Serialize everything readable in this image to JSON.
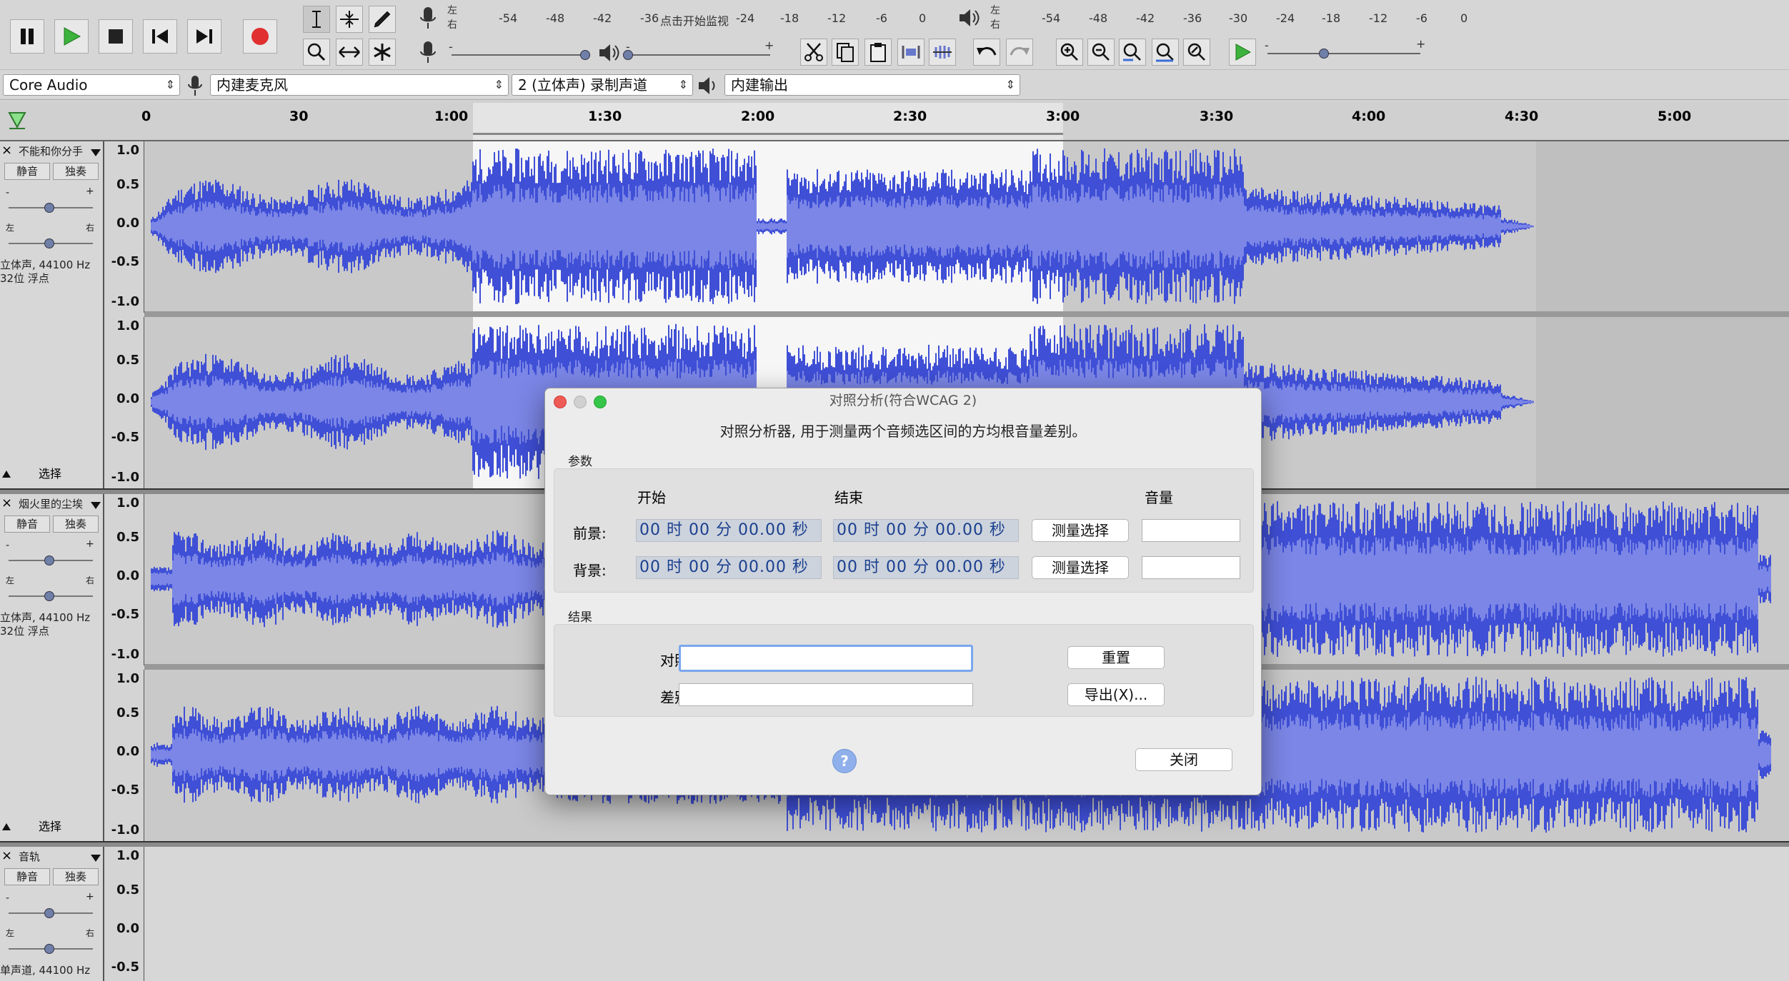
{
  "toolbar": {
    "meter_rec_lr": [
      "左",
      "右"
    ],
    "meter_rec_ticks": [
      "-54",
      "-48",
      "-42",
      "-36",
      "点击开始监视",
      "-24",
      "-18",
      "-12",
      "-6",
      "0"
    ],
    "meter_play_lr": [
      "左",
      "右"
    ],
    "meter_play_ticks": [
      "-54",
      "-48",
      "-42",
      "-36",
      "-30",
      "-24",
      "-18",
      "-12",
      "-6",
      "0"
    ],
    "slider_minus": "-",
    "slider_plus": "+"
  },
  "devices": {
    "host": "Core Audio",
    "input": "内建麦克风",
    "channels": "2 (立体声) 录制声道",
    "output": "内建输出"
  },
  "timeline": {
    "ticks": [
      "0",
      "30",
      "1:00",
      "1:30",
      "2:00",
      "2:30",
      "3:00",
      "3:30",
      "4:00",
      "4:30",
      "5:00"
    ]
  },
  "scale": [
    "1.0",
    "0.5",
    "0.0",
    "-0.5",
    "-1.0"
  ],
  "tracks": [
    {
      "title": "不能和你分手",
      "mute": "静音",
      "solo": "独奏",
      "gain_minus": "-",
      "gain_plus": "+",
      "pan_left": "左",
      "pan_right": "右",
      "format_line1": "立体声, 44100 Hz",
      "format_line2": "32位 浮点",
      "select": "选择"
    },
    {
      "title": "烟火里的尘埃",
      "mute": "静音",
      "solo": "独奏",
      "gain_minus": "-",
      "gain_plus": "+",
      "pan_left": "左",
      "pan_right": "右",
      "format_line1": "立体声, 44100 Hz",
      "format_line2": "32位 浮点",
      "select": "选择"
    },
    {
      "title": "音轨",
      "mute": "静音",
      "solo": "独奏",
      "gain_minus": "-",
      "gain_plus": "+",
      "pan_left": "左",
      "pan_right": "右",
      "format_line1": "单声道, 44100 Hz"
    }
  ],
  "colors": {
    "waveform": "#3f4fd6",
    "waveform_rms": "#7b86e6",
    "track_bg": "#c9c9c9",
    "selection_bg": "#ffffff",
    "accent_blue": "#3b82f6"
  },
  "dialog": {
    "title": "对照分析(符合WCAG 2)",
    "description": "对照分析器, 用于测量两个音频选区间的方均根音量差别。",
    "params_label": "参数",
    "col_start": "开始",
    "col_end": "结束",
    "col_volume": "音量",
    "foreground_label": "前景:",
    "background_label": "背景:",
    "time_value": "00 时 00 分 00.00 秒",
    "measure_button": "测量选择",
    "results_label": "结果",
    "contrast_result_label": "对照结果:",
    "difference_label": "差别:",
    "reset_button": "重置",
    "export_button": "导出(X)...",
    "help_glyph": "?",
    "close_button": "关闭"
  }
}
